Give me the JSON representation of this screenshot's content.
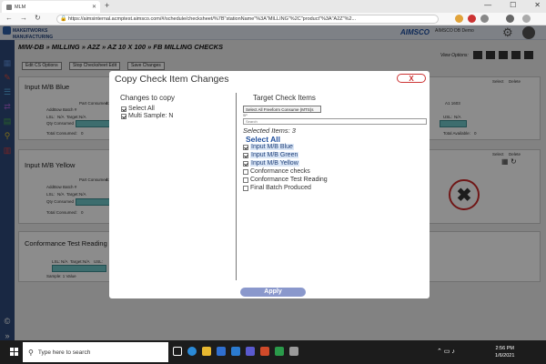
{
  "browser": {
    "tab_title": "MLM",
    "url": "https://aimsinternal.acmptest.aimsco.com/#/schedule/checksheet/%7B\"stationName\"%3A\"MILLING\"%2C\"product\"%3A\"A2Z\"%2..."
  },
  "header": {
    "logo_line1": "MAKEITWORKS",
    "logo_line2": "MANUFACTURING",
    "brand": "AIMSCO",
    "user_label": "AIMSCO DB Demo"
  },
  "page": {
    "breadcrumb": "MIW-DB  »  MILLING  »  A2Z  »  AZ 10 X 100  »  FB MILLING CHECKS",
    "view_options_label": "View Options:",
    "buttons": {
      "edit_cs_options": "Edit CS Options",
      "stop_checksheet_edit": "Stop Checksheet Edit",
      "save_changes": "Save Changes"
    }
  },
  "cards": [
    {
      "title": "Input M/B Blue",
      "part_consumed": "Part Consumed:",
      "part_value": "A1-5",
      "addbow": "AddBow Batch #",
      "lsl": "LSL:",
      "lsl_val": "N/A",
      "target": "Target:",
      "target_val": "N/A",
      "qty_consumed": "Qty Consumed",
      "total_consumed": "Total Consumed:",
      "total_val": "0",
      "right_code": "A1 1603",
      "usl": "USL:",
      "usl_val": "N/A",
      "right_total": "Total Available:",
      "right_total_val": "0",
      "select": "Select",
      "delete": "Delete"
    },
    {
      "title": "Input M/B Yellow",
      "part_consumed": "Part Consumed:",
      "part_value": "A1 1",
      "addbow": "AddBow Batch #",
      "lsl": "LSL:",
      "lsl_val": "N/A",
      "target": "Target:",
      "target_val": "N/A",
      "qty_consumed": "Qty Consumed",
      "total_consumed": "Total Consumed:",
      "total_val": "0",
      "select": "Select",
      "delete": "Delete"
    },
    {
      "title": "Conformance Test Reading",
      "lsl": "LSL:",
      "lsl_val": "N/A",
      "target": "Target:",
      "target_val": "N/A",
      "usl": "USL:",
      "sample": "Sample: 1 Value"
    }
  ],
  "dialog": {
    "title": "Copy Check Item Changes",
    "close_label": "X",
    "left_heading": "Changes to copy",
    "changes": [
      {
        "label": "Select All",
        "checked": true
      },
      {
        "label": "Multi Sample: N",
        "checked": true
      }
    ],
    "right_heading": "Target Check Items",
    "select_all_freeform": "Select All Freeform Consume (MTS)s",
    "tiny_label": "SP",
    "search_placeholder": "Search",
    "selected_items": "Selected Items:  3",
    "select_all_link": "Select All",
    "targets": [
      {
        "label": "Input M/B Blue",
        "checked": true,
        "highlight": true
      },
      {
        "label": "Input M/B Green",
        "checked": true,
        "highlight": true
      },
      {
        "label": "Input M/B Yellow",
        "checked": true,
        "highlight": true
      },
      {
        "label": "Conformance checks",
        "checked": false,
        "highlight": false
      },
      {
        "label": "Conformance Test Reading",
        "checked": false,
        "highlight": false
      },
      {
        "label": "Final Batch Produced",
        "checked": false,
        "highlight": false
      }
    ],
    "apply_label": "Apply"
  },
  "taskbar": {
    "search_placeholder": "Type here to search",
    "time": "2:56 PM",
    "date": "1/6/2021"
  },
  "colors": {
    "accent": "#2e4a7a",
    "apply": "#8a98cc",
    "close": "#cc3333",
    "teal": "#6fc6c9"
  }
}
